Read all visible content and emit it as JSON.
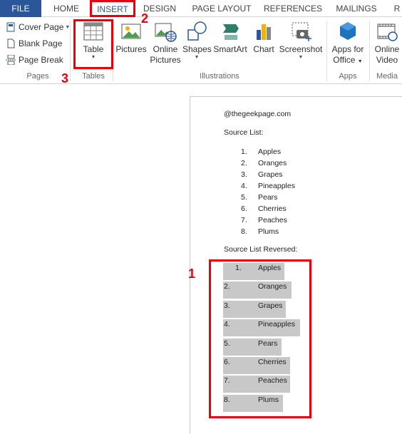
{
  "ribbon": {
    "tabs": [
      "FILE",
      "HOME",
      "INSERT",
      "DESIGN",
      "PAGE LAYOUT",
      "REFERENCES",
      "MAILINGS",
      "R"
    ],
    "pages_group": {
      "label": "Pages",
      "cover_page": "Cover Page",
      "blank_page": "Blank Page",
      "page_break": "Page Break"
    },
    "tables_group": {
      "label": "Tables",
      "table": "Table"
    },
    "illustrations_group": {
      "label": "Illustrations",
      "pictures": "Pictures",
      "online_pictures_1": "Online",
      "online_pictures_2": "Pictures",
      "shapes": "Shapes",
      "smartart": "SmartArt",
      "chart": "Chart",
      "screenshot": "Screenshot"
    },
    "apps_group": {
      "label": "Apps",
      "apps_1": "Apps for",
      "apps_2": "Office"
    },
    "media_group": {
      "label": "Media",
      "video_1": "Online",
      "video_2": "Video"
    }
  },
  "document": {
    "watermark": "@thegeekpage.com",
    "source_heading": "Source List:",
    "source_list": [
      {
        "n": "1.",
        "t": "Apples"
      },
      {
        "n": "2.",
        "t": "Oranges"
      },
      {
        "n": "3.",
        "t": "Grapes"
      },
      {
        "n": "4.",
        "t": "Pineapples"
      },
      {
        "n": "5.",
        "t": "Pears"
      },
      {
        "n": "6.",
        "t": "Cherries"
      },
      {
        "n": "7.",
        "t": "Peaches"
      },
      {
        "n": "8.",
        "t": "Plums"
      }
    ],
    "reversed_heading": "Source List Reversed:",
    "reversed_list": [
      {
        "n": "1.",
        "t": "Apples"
      },
      {
        "n": "2.",
        "t": "Oranges"
      },
      {
        "n": "3.",
        "t": "Grapes"
      },
      {
        "n": "4.",
        "t": "Pineapples"
      },
      {
        "n": "5.",
        "t": "Pears"
      },
      {
        "n": "6.",
        "t": "Cherries"
      },
      {
        "n": "7.",
        "t": "Peaches"
      },
      {
        "n": "8.",
        "t": "Plums"
      }
    ]
  },
  "annotations": {
    "step1": "1",
    "step2": "2",
    "step3": "3"
  },
  "colors": {
    "file_tab": "#2b579a",
    "annotation": "#e8000d",
    "selection": "#c8c8c8"
  }
}
